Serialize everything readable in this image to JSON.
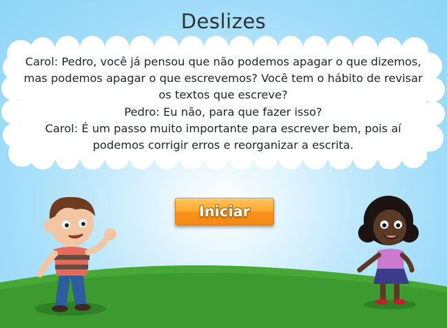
{
  "title": "Deslizes",
  "dialog": {
    "lines": [
      "Carol: Pedro, você já pensou que não podemos apagar o que dizemos,",
      "mas podemos apagar o que escrevemos? Você tem o hábito de revisar",
      "os textos que escreve?",
      "Pedro: Eu não, para que fazer isso?",
      "Carol: É um passo muito importante para escrever bem, pois aí",
      "podemos corrigir erros e reorganizar a escrita."
    ]
  },
  "start_button": {
    "label": "Iniciar"
  },
  "colors": {
    "sky": "#8fd5f7",
    "grass": "#3c9a2e",
    "button": "#f7921a",
    "cloud": "#ffffff"
  }
}
